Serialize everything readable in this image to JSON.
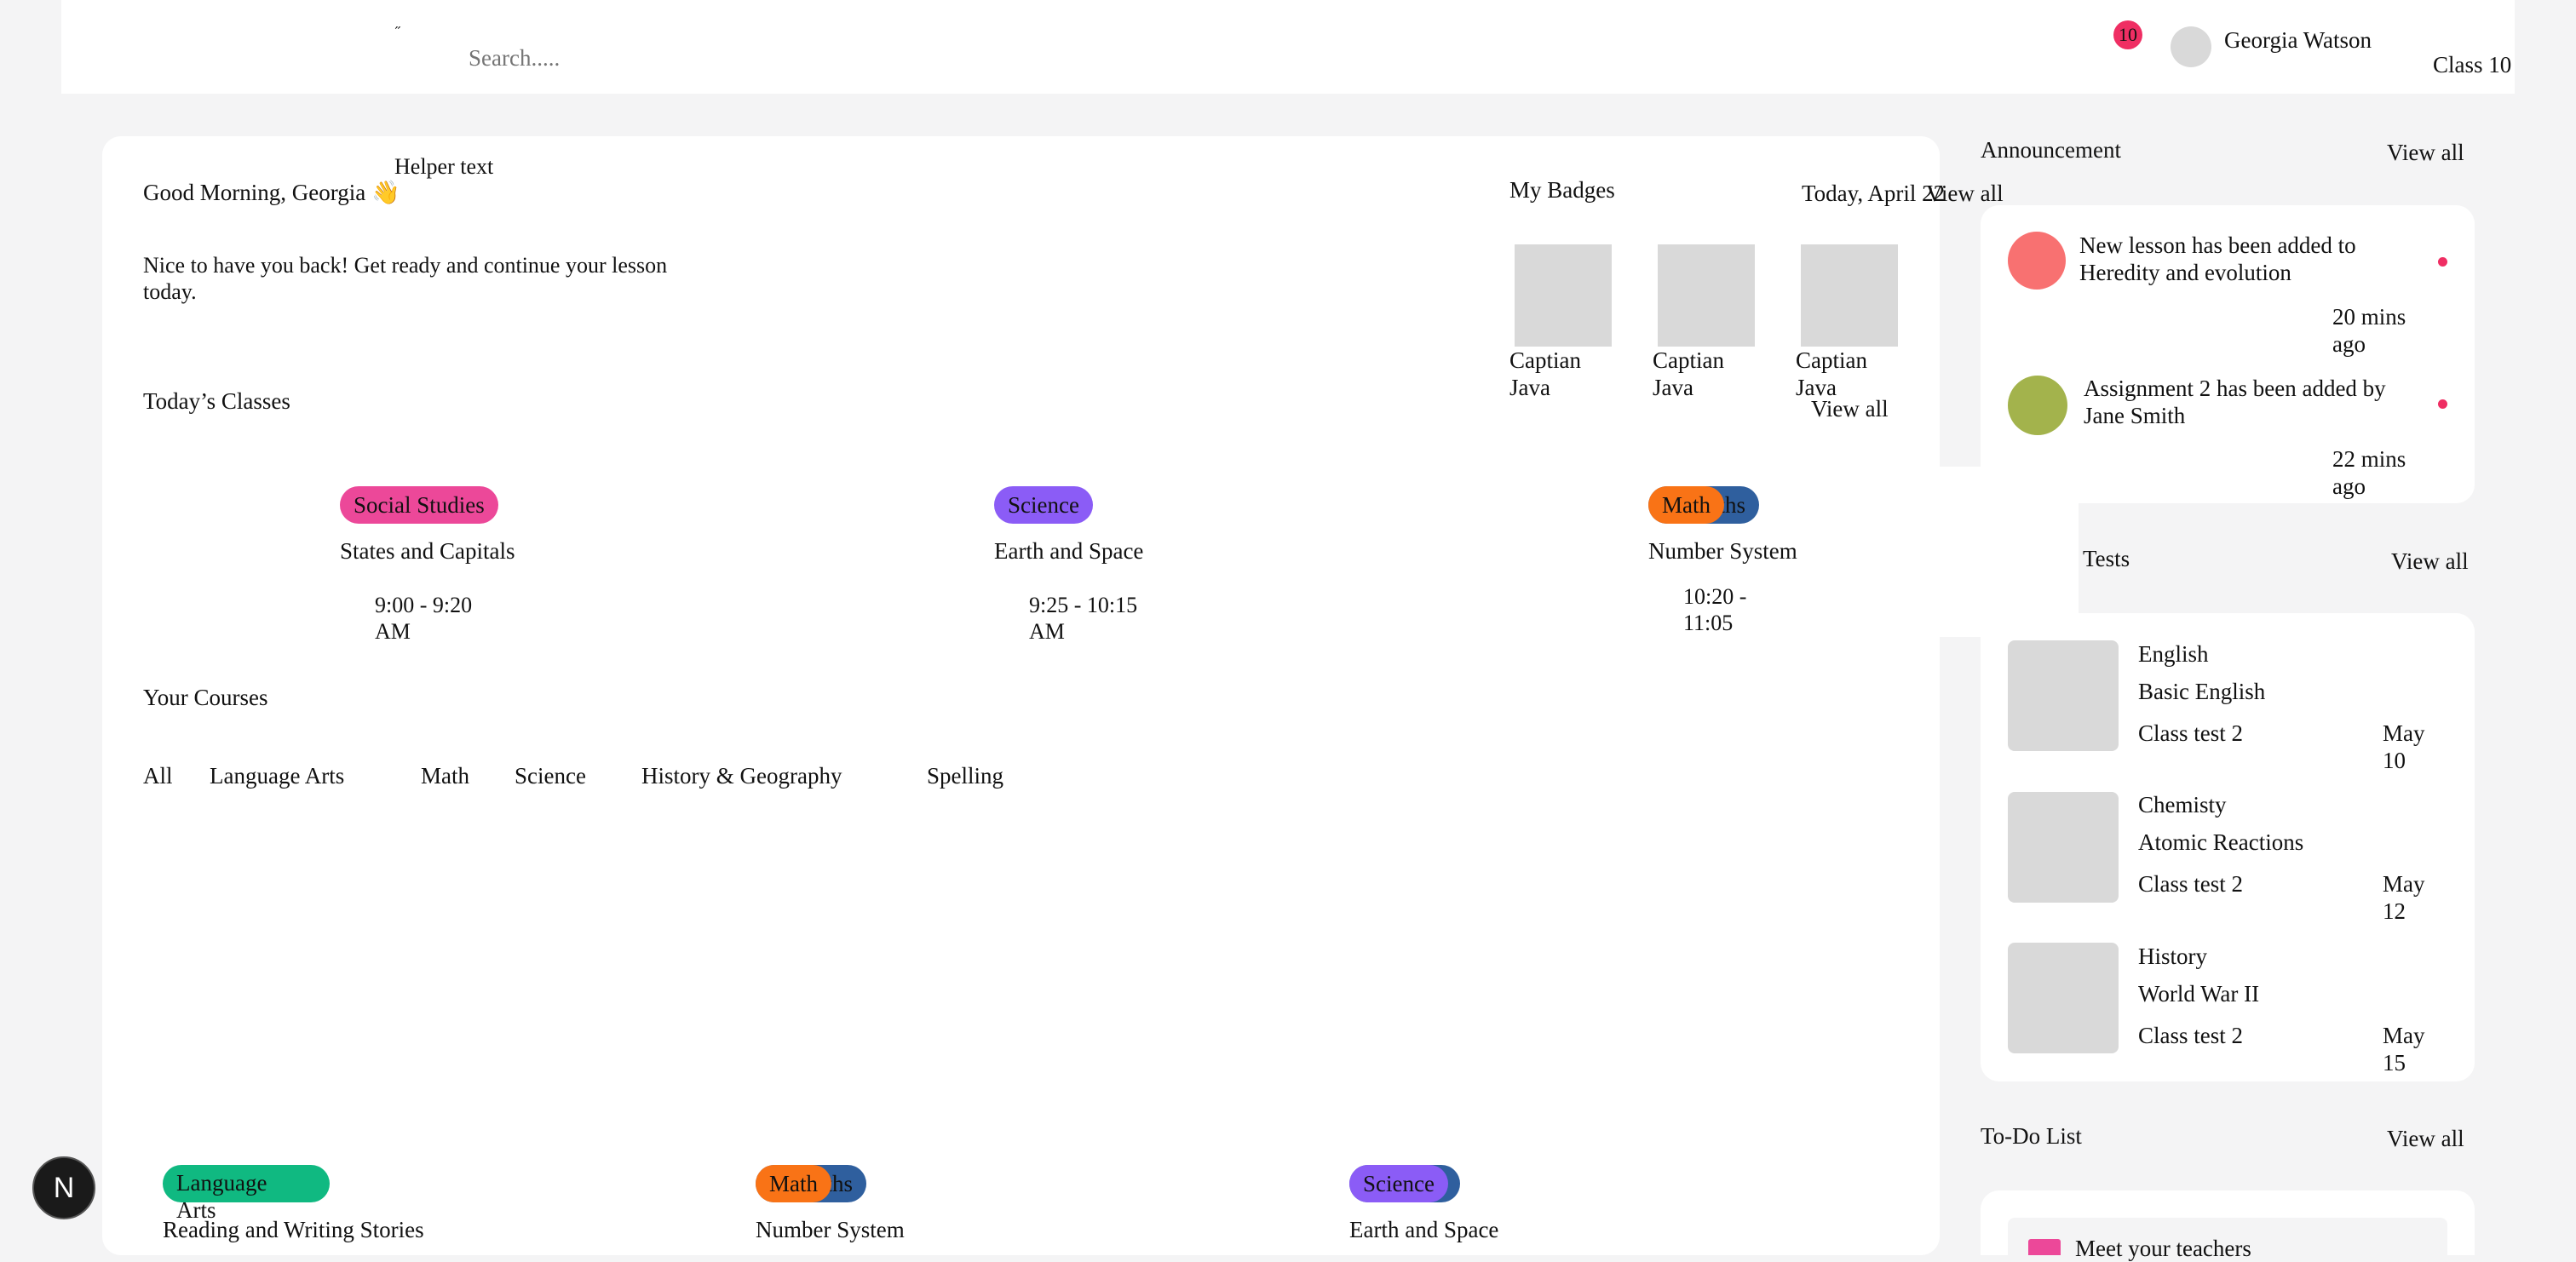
{
  "topbar": {
    "search_placeholder": "Search.....",
    "notification_count": "10",
    "user_name": "Georgia Watson",
    "user_class": "Class 10"
  },
  "main": {
    "helper_text": "Helper text",
    "greeting": "Good Morning, Georgia 👋",
    "subtitle": "Nice to have you back! Get ready and continue your lesson today.",
    "date": "Today, April 22"
  },
  "badges": {
    "title": "My Badges",
    "view_all": "View all",
    "view_all_2": "View all",
    "items": [
      {
        "label": "Captian Java"
      },
      {
        "label": "Captian Java"
      },
      {
        "label": "Captian Java"
      }
    ]
  },
  "todays_classes": {
    "title": "Today’s Classes",
    "items": [
      {
        "tag": "Social Studies",
        "title": "States and Capitals",
        "time": "9:00 - 9:20 AM"
      },
      {
        "tag": "Science",
        "title": "Earth and Space",
        "time": "9:25 - 10:15 AM"
      },
      {
        "tag": "Math",
        "tag_under": "Maths",
        "title": "Number System",
        "time": "10:20 - 11:05"
      }
    ]
  },
  "courses": {
    "title": "Your Courses",
    "tabs": [
      "All",
      "Language Arts",
      "Math",
      "Science",
      "History & Geography",
      "Spelling"
    ],
    "cards": [
      {
        "tag": "Language Arts",
        "title": "Reading and Writing Stories"
      },
      {
        "tag": "Math",
        "tag_under": "Maths",
        "title": "Number System"
      },
      {
        "tag": "Science",
        "title": "Earth and Space"
      }
    ]
  },
  "announcements": {
    "title": "Announcement",
    "view_all": "View all",
    "items": [
      {
        "text": "New lesson has been added to Heredity and evolution",
        "time": "20 mins ago",
        "avatar_color": "#f87171"
      },
      {
        "text": "Assignment 2 has been added by Jane Smith",
        "time": "22 mins ago",
        "avatar_color": "#a3b34c"
      }
    ]
  },
  "tests": {
    "title": "Tests",
    "view_all": "View all",
    "items": [
      {
        "subject": "English",
        "topic": "Basic English",
        "kind": "Class test 2",
        "date": "May 10"
      },
      {
        "subject": "Chemisty",
        "topic": "Atomic Reactions",
        "kind": "Class test 2",
        "date": "May 12"
      },
      {
        "subject": "History",
        "topic": "World War II",
        "kind": "Class test 2",
        "date": "May 15"
      }
    ]
  },
  "todo": {
    "title": "To-Do List",
    "view_all": "View all",
    "items": [
      {
        "text": "Meet your teachers",
        "color": "#ec4899"
      }
    ]
  },
  "fab": {
    "letter": "N"
  }
}
